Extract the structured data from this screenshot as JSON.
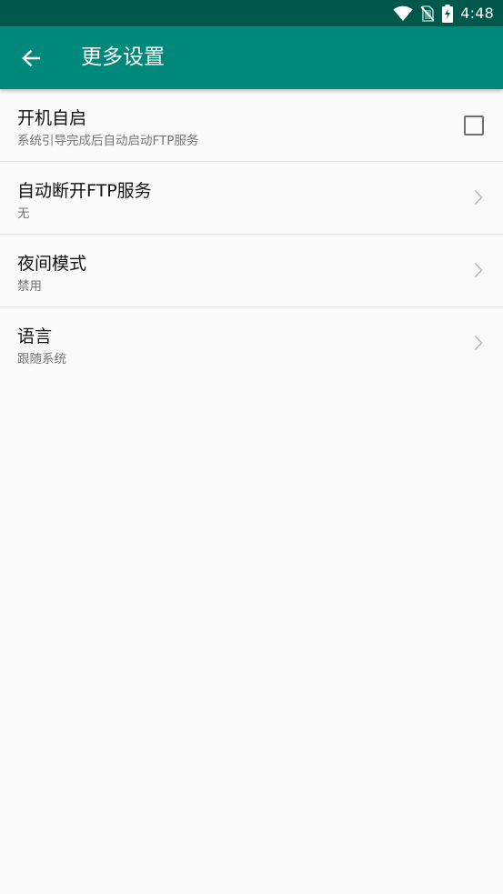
{
  "status_bar": {
    "time": "4:48",
    "icons": [
      "wifi-icon",
      "no-sim-icon",
      "battery-charging-icon"
    ]
  },
  "app_bar": {
    "back_icon": "arrow-left-icon",
    "title": "更多设置"
  },
  "settings": [
    {
      "title": "开机自启",
      "subtitle": "系统引导完成后自动启动FTP服务",
      "control": "checkbox",
      "checked": false
    },
    {
      "title": "自动断开FTP服务",
      "subtitle": "无",
      "control": "chevron-right-icon"
    },
    {
      "title": "夜间模式",
      "subtitle": "禁用",
      "control": "chevron-right-icon"
    },
    {
      "title": "语言",
      "subtitle": "跟随系统",
      "control": "chevron-right-icon"
    }
  ],
  "colors": {
    "status_bar": "#00574b",
    "app_bar": "#00897b",
    "background": "#fafafa"
  }
}
